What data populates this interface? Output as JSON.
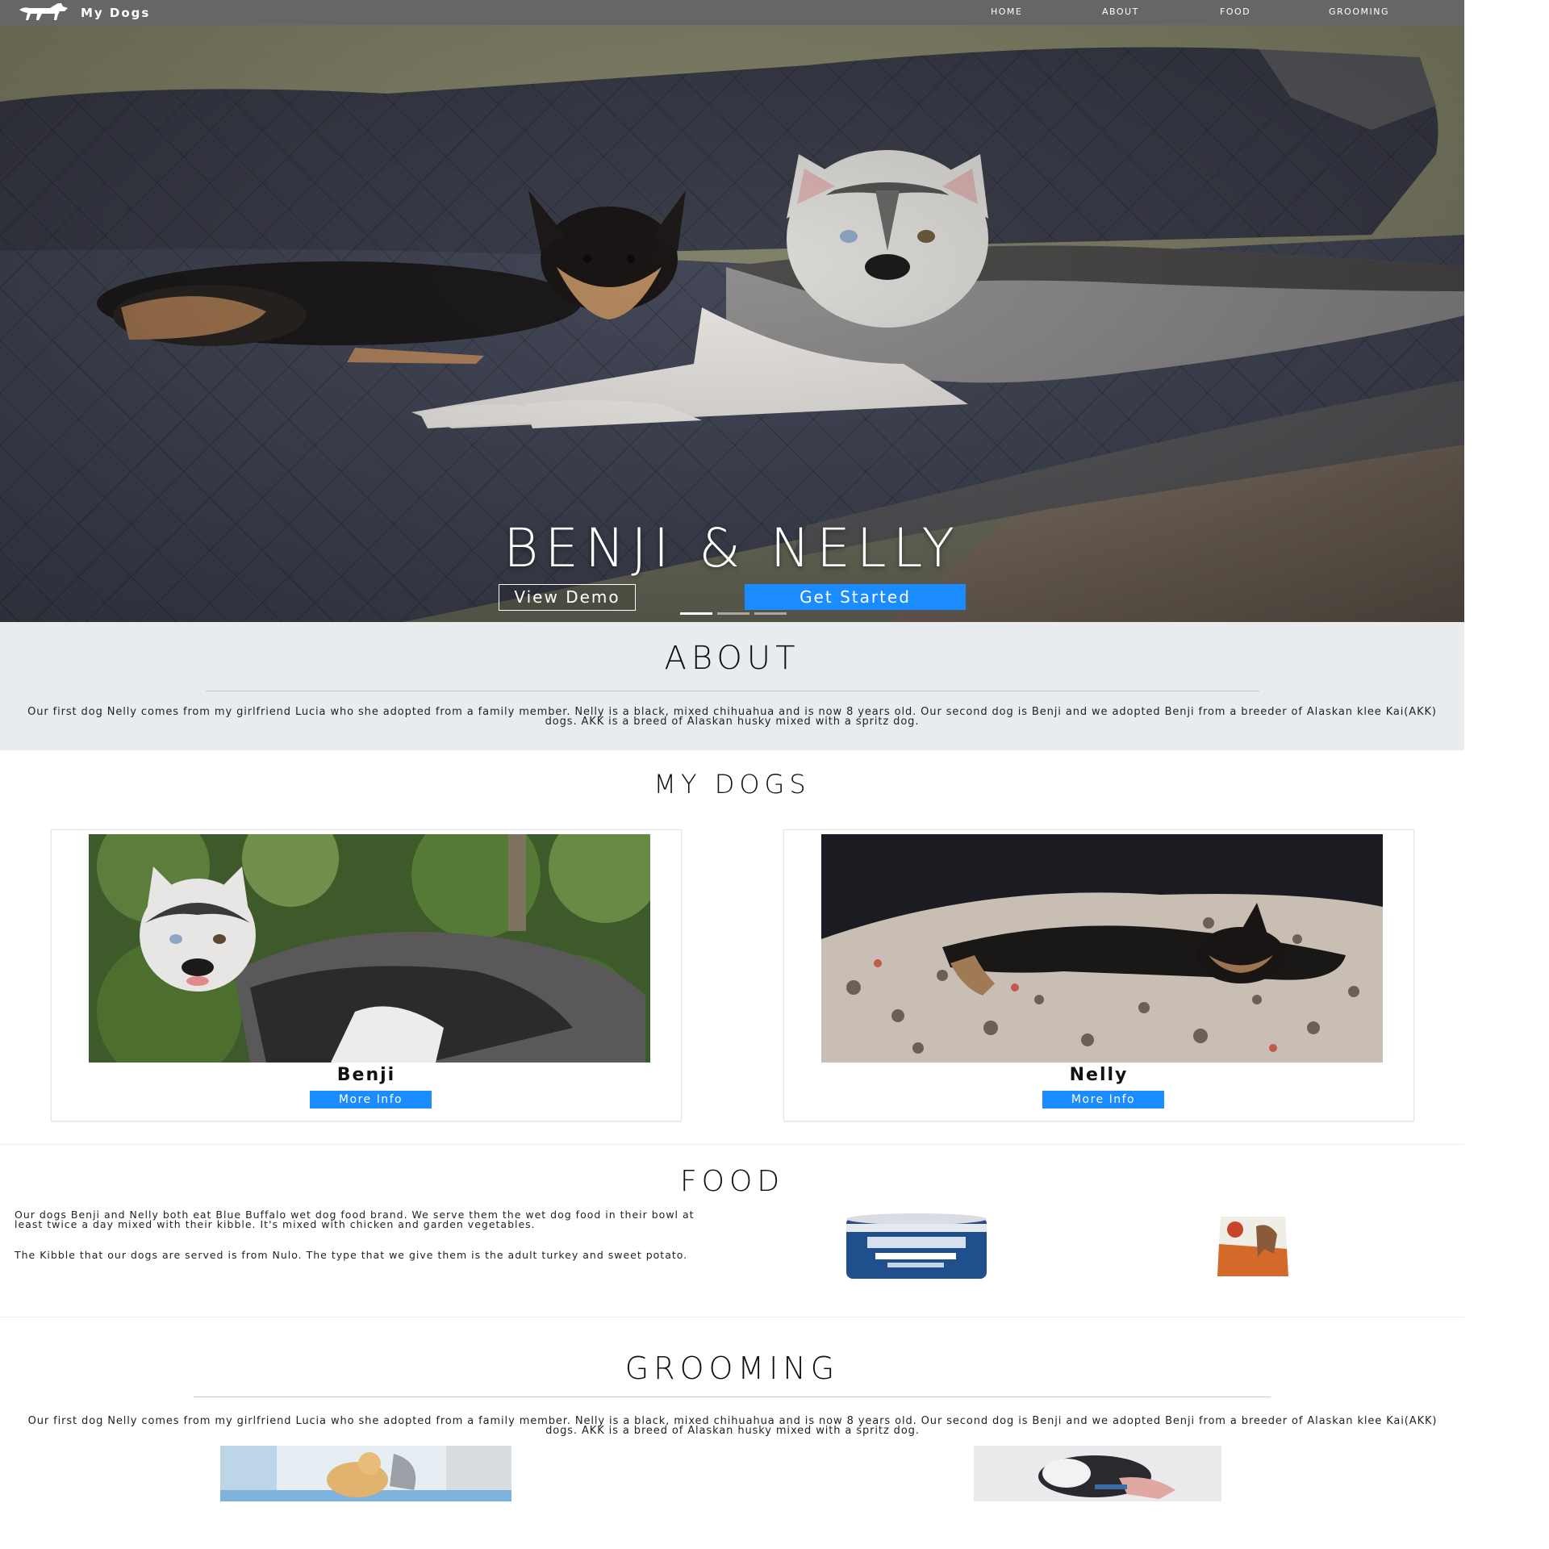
{
  "nav": {
    "brand": "My Dogs",
    "brand_icon": "dog-silhouette-icon",
    "links": [
      "HOME",
      "ABOUT",
      "FOOD",
      "GROOMING"
    ]
  },
  "hero": {
    "title": "BENJI & NELLY",
    "view_demo": "View Demo",
    "get_started": "Get Started",
    "slide_count": 3,
    "active_slide": 1
  },
  "about": {
    "title": "ABOUT",
    "text": "Our first dog Nelly comes from my girlfriend Lucia who she adopted from a family member. Nelly is a black, mixed chihuahua and is now 8 years old. Our second dog is Benji and we adopted Benji from a breeder of Alaskan klee Kai(AKK) dogs. AKK is a breed of Alaskan husky mixed with a spritz dog."
  },
  "dogs": {
    "title": "MY DOGS",
    "cards": [
      {
        "name": "Benji",
        "button": "More Info"
      },
      {
        "name": "Nelly",
        "button": "More Info"
      }
    ]
  },
  "food": {
    "title": "FOOD",
    "paragraphs": [
      "Our dogs Benji and Nelly both eat Blue Buffalo wet dog food brand. We serve them the wet dog food in their bowl at least twice a day mixed with their kibble. It's mixed with chicken and garden vegetables.",
      "The Kibble that our dogs are served is from Nulo. The type that we give them is the adult turkey and sweet potato."
    ]
  },
  "grooming": {
    "title": "GROOMING",
    "text": "Our first dog Nelly comes from my girlfriend Lucia who she adopted from a family member. Nelly is a black, mixed chihuahua and is now 8 years old. Our second dog is Benji and we adopted Benji from a breeder of Alaskan klee Kai(AKK) dogs. AKK is a breed of Alaskan husky mixed with a spritz dog."
  },
  "colors": {
    "nav_bg": "#666666",
    "primary": "#1a8cff",
    "about_bg": "#e9ecef"
  }
}
